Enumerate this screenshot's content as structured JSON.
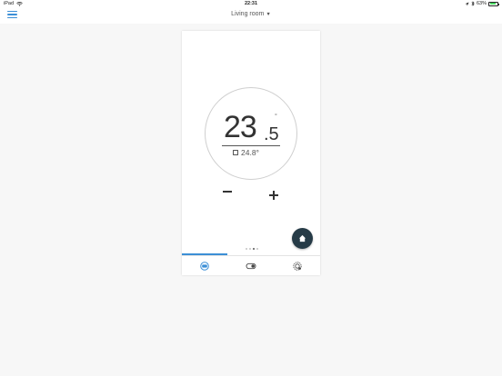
{
  "status_bar": {
    "device": "iPad",
    "time": "22:31",
    "battery": "63%"
  },
  "header": {
    "room_name": "Living room"
  },
  "thermostat": {
    "temperature_integer": "23",
    "temperature_decimal": ".5",
    "degree_symbol": "°",
    "scheduled_temp": "24.8°"
  },
  "colors": {
    "accent": "#3c8fd6",
    "fab_background": "#263b47",
    "card_background": "#ffffff",
    "page_background": "#f7f7f7"
  },
  "tabs": [
    {
      "icon": "thermostat-icon",
      "active": true
    },
    {
      "icon": "toggle-icon",
      "active": false
    },
    {
      "icon": "settings-icon",
      "active": false
    }
  ],
  "page_dots": {
    "count": 4,
    "active_index": 2
  }
}
